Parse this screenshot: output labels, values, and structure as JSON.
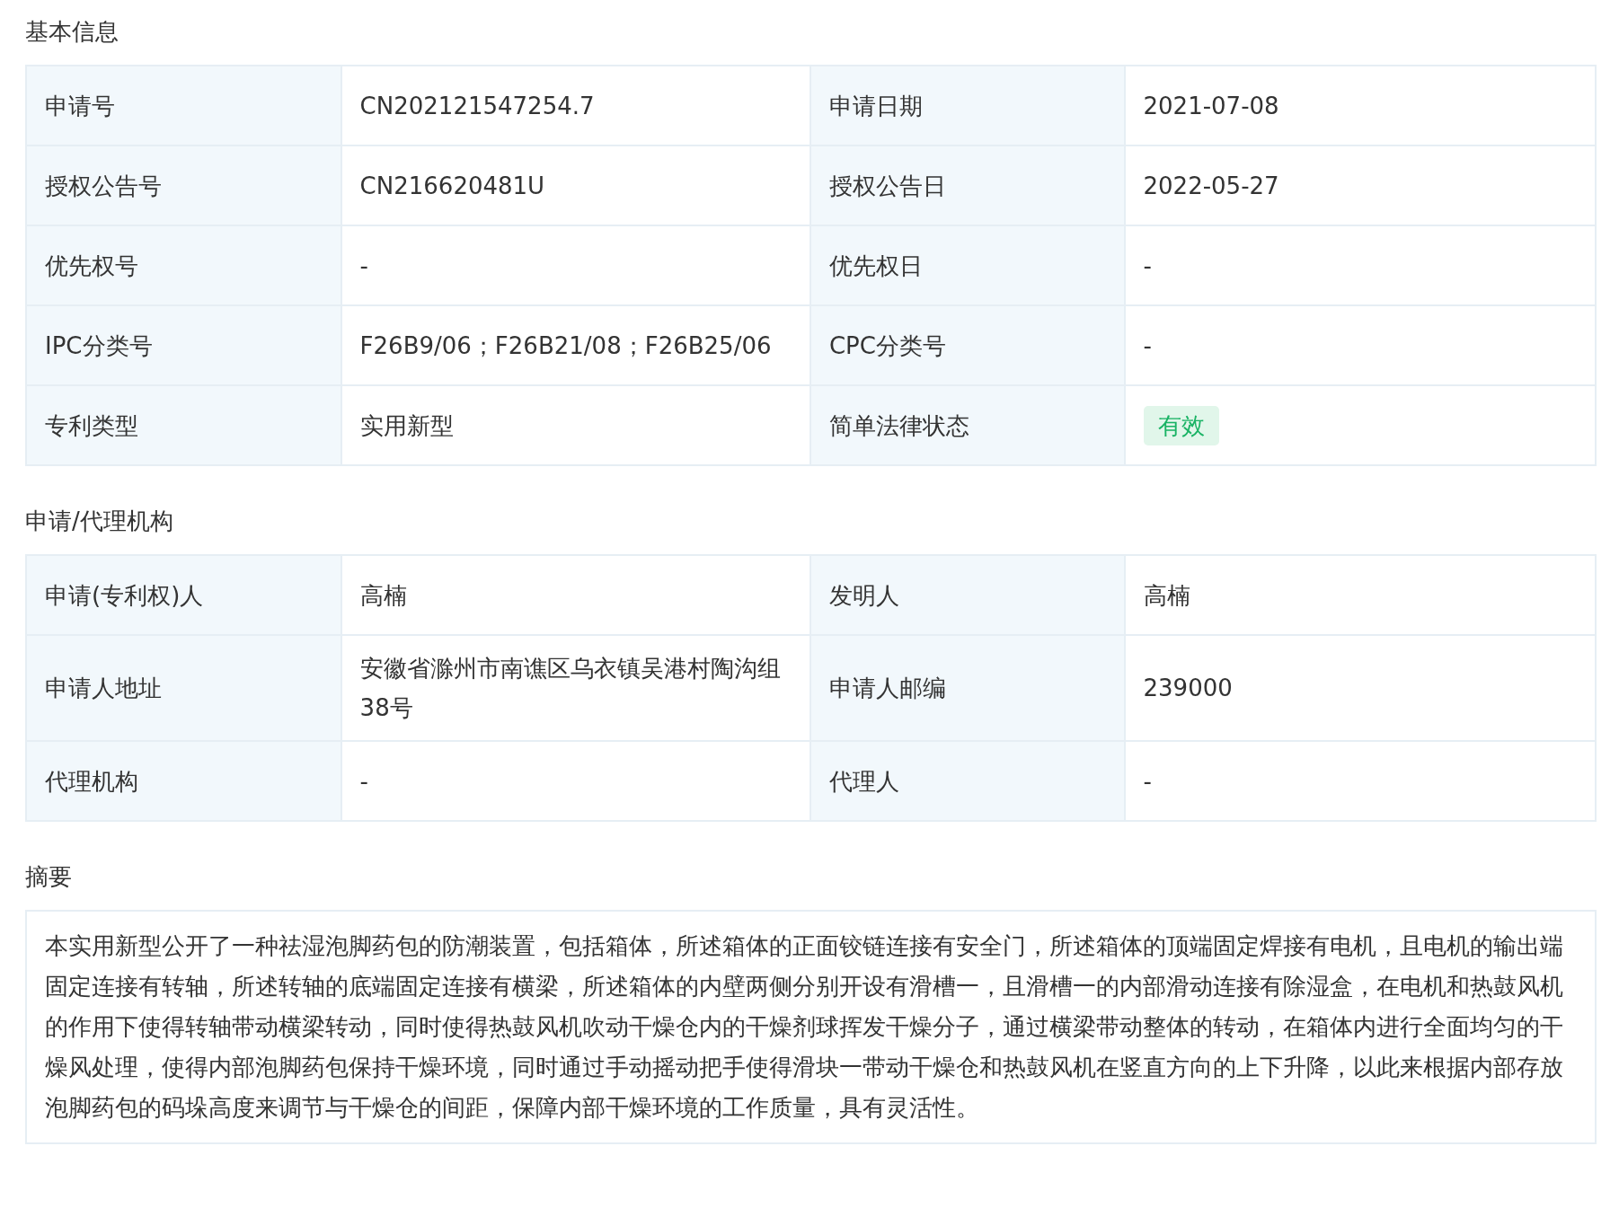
{
  "sections": [
    {
      "title": "基本信息",
      "rows": [
        [
          {
            "label": "申请号",
            "value": "CN202121547254.7",
            "kind": "text"
          },
          {
            "label": "申请日期",
            "value": "2021-07-08",
            "kind": "text"
          }
        ],
        [
          {
            "label": "授权公告号",
            "value": "CN216620481U",
            "kind": "text"
          },
          {
            "label": "授权公告日",
            "value": "2022-05-27",
            "kind": "text"
          }
        ],
        [
          {
            "label": "优先权号",
            "value": "-",
            "kind": "text"
          },
          {
            "label": "优先权日",
            "value": "-",
            "kind": "text"
          }
        ],
        [
          {
            "label": "IPC分类号",
            "value": "F26B9/06；F26B21/08；F26B25/06",
            "kind": "text"
          },
          {
            "label": "CPC分类号",
            "value": "-",
            "kind": "text"
          }
        ],
        [
          {
            "label": "专利类型",
            "value": "实用新型",
            "kind": "text"
          },
          {
            "label": "简单法律状态",
            "value": "有效",
            "kind": "badge"
          }
        ]
      ]
    },
    {
      "title": "申请/代理机构",
      "rows": [
        [
          {
            "label": "申请(专利权)人",
            "value": "高楠",
            "kind": "text"
          },
          {
            "label": "发明人",
            "value": "高楠",
            "kind": "text"
          }
        ],
        [
          {
            "label": "申请人地址",
            "value": "安徽省滁州市南谯区乌衣镇吴港村陶沟组38号",
            "kind": "text"
          },
          {
            "label": "申请人邮编",
            "value": "239000",
            "kind": "text"
          }
        ],
        [
          {
            "label": "代理机构",
            "value": "-",
            "kind": "text"
          },
          {
            "label": "代理人",
            "value": "-",
            "kind": "text"
          }
        ]
      ]
    },
    {
      "title": "摘要",
      "text": "本实用新型公开了一种祛湿泡脚药包的防潮装置，包括箱体，所述箱体的正面铰链连接有安全门，所述箱体的顶端固定焊接有电机，且电机的输出端固定连接有转轴，所述转轴的底端固定连接有横梁，所述箱体的内壁两侧分别开设有滑槽一，且滑槽一的内部滑动连接有除湿盒，在电机和热鼓风机的作用下使得转轴带动横梁转动，同时使得热鼓风机吹动干燥仓内的干燥剂球挥发干燥分子，通过横梁带动整体的转动，在箱体内进行全面均匀的干燥风处理，使得内部泡脚药包保持干燥环境，同时通过手动摇动把手使得滑块一带动干燥仓和热鼓风机在竖直方向的上下升降，以此来根据内部存放泡脚药包的码垛高度来调节与干燥仓的间距，保障内部干燥环境的工作质量，具有灵活性。"
    }
  ]
}
